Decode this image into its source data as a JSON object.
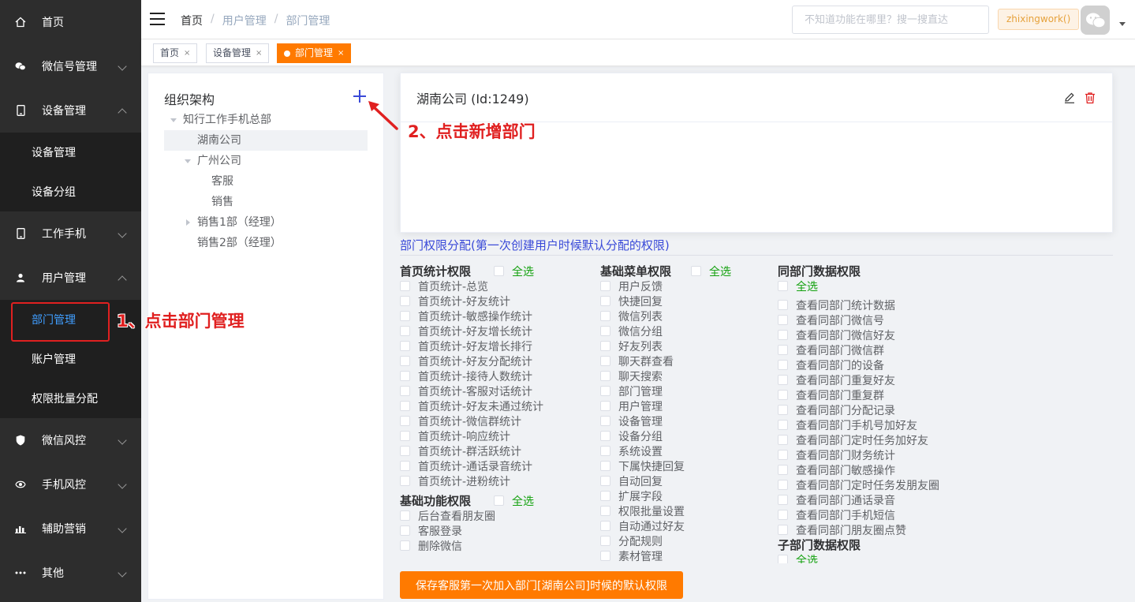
{
  "sidebar": {
    "items": [
      {
        "label": "首页",
        "icon": "home-icon"
      },
      {
        "label": "微信号管理",
        "icon": "wechat-icon"
      },
      {
        "label": "设备管理",
        "icon": "phone-icon"
      },
      {
        "label": "工作手机",
        "icon": "mobile-icon"
      },
      {
        "label": "用户管理",
        "icon": "user-icon"
      },
      {
        "label": "微信风控",
        "icon": "shield-icon"
      },
      {
        "label": "手机风控",
        "icon": "risk-icon"
      },
      {
        "label": "辅助营销",
        "icon": "chart-icon"
      },
      {
        "label": "其他",
        "icon": "more-icon"
      }
    ],
    "device_sub": [
      "设备管理",
      "设备分组"
    ],
    "user_sub": [
      "部门管理",
      "账户管理",
      "权限批量分配"
    ]
  },
  "header": {
    "breadcrumb": [
      "首页",
      "用户管理",
      "部门管理"
    ],
    "search_placeholder": "不知道功能在哪里？搜一搜直达",
    "username": "zhixingwork()"
  },
  "tags": [
    {
      "label": "首页",
      "close": "×"
    },
    {
      "label": "设备管理",
      "close": "×"
    },
    {
      "label": "部门管理",
      "close": "×",
      "active": true
    }
  ],
  "org": {
    "title": "组织架构",
    "nodes": [
      "知行工作手机总部",
      "湖南公司",
      "广州公司",
      "客服",
      "销售",
      "销售1部（经理）",
      "销售2部（经理）"
    ]
  },
  "detail": {
    "title": "湖南公司 (Id:1249)"
  },
  "perm": {
    "title": "部门权限分配(第一次创建用户时候默认分配的权限)",
    "select_all": "全选",
    "home_stats": {
      "name": "首页统计权限",
      "items": [
        "首页统计-总览",
        "首页统计-好友统计",
        "首页统计-敏感操作统计",
        "首页统计-好友增长统计",
        "首页统计-好友增长排行",
        "首页统计-好友分配统计",
        "首页统计-接待人数统计",
        "首页统计-客服对话统计",
        "首页统计-好友未通过统计",
        "首页统计-微信群统计",
        "首页统计-响应统计",
        "首页统计-群活跃统计",
        "首页统计-通话录音统计",
        "首页统计-进粉统计"
      ]
    },
    "basic_func": {
      "name": "基础功能权限",
      "items": [
        "后台查看朋友圈",
        "客服登录",
        "删除微信"
      ]
    },
    "basic_menu": {
      "name": "基础菜单权限",
      "items": [
        "用户反馈",
        "快捷回复",
        "微信列表",
        "微信分组",
        "好友列表",
        "聊天群查看",
        "聊天搜索",
        "部门管理",
        "用户管理",
        "设备管理",
        "设备分组",
        "系统设置",
        "下属快捷回复",
        "自动回复",
        "扩展字段",
        "权限批量设置",
        "自动通过好友",
        "分配规则",
        "素材管理"
      ]
    },
    "same_dept": {
      "name": "同部门数据权限",
      "items": [
        "查看同部门统计数据",
        "查看同部门微信号",
        "查看同部门微信好友",
        "查看同部门微信群",
        "查看同部门的设备",
        "查看同部门重复好友",
        "查看同部门重复群",
        "查看同部门分配记录",
        "查看同部门手机号加好友",
        "查看同部门定时任务加好友",
        "查看同部门财务统计",
        "查看同部门敏感操作",
        "查看同部门定时任务发朋友圈",
        "查看同部门通话录音",
        "查看同部门手机短信",
        "查看同部门朋友圈点赞"
      ]
    },
    "sub_dept": {
      "name": "子部门数据权限"
    }
  },
  "save_button": "保存客服第一次加入部门[湖南公司]时候的默认权限",
  "annotations": {
    "step1": "1、点击部门管理",
    "step2": "2、点击新增部门"
  },
  "colors": {
    "accent": "#ff7a00",
    "link": "#3a4ad8",
    "annotation": "#e02020",
    "select_all": "#13a10e",
    "sidebar_bg": "#2d2d2d"
  }
}
